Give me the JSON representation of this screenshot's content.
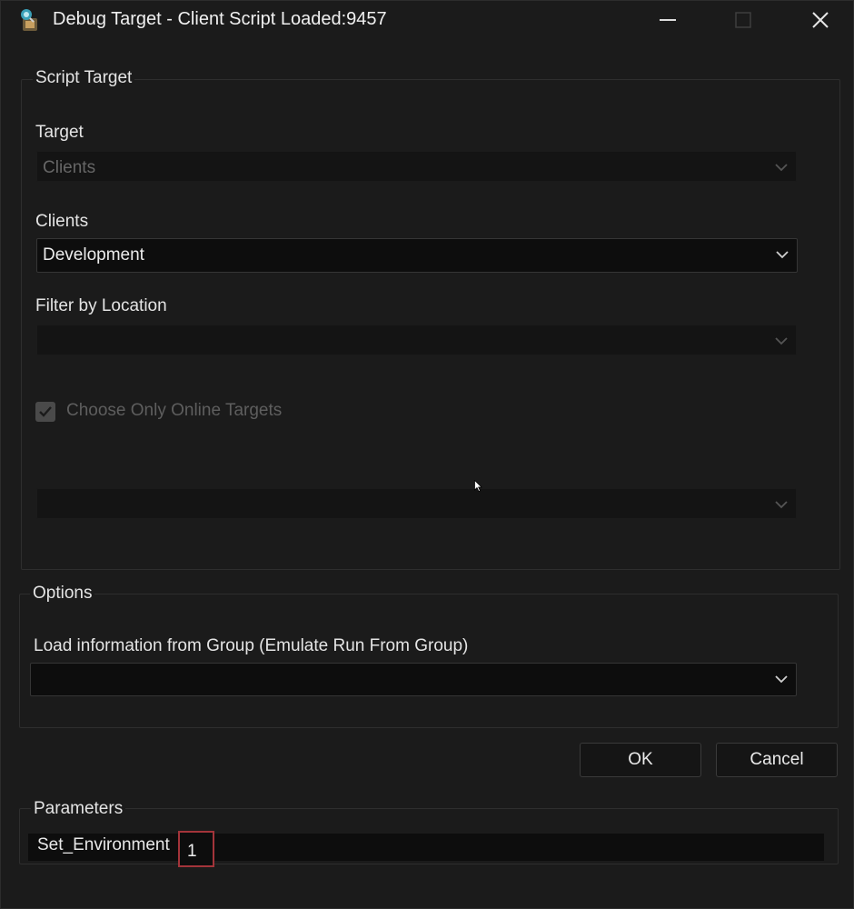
{
  "window": {
    "title": "Debug Target - Client Script Loaded:9457",
    "icons": {
      "app": "debug-bug-icon",
      "minimize": "minimize-icon",
      "maximize": "maximize-icon",
      "close": "close-icon"
    }
  },
  "script_target": {
    "legend": "Script Target",
    "target": {
      "label": "Target",
      "value": "Clients",
      "enabled": false
    },
    "clients": {
      "label": "Clients",
      "value": "Development",
      "enabled": true
    },
    "filter_location": {
      "label": "Filter by Location",
      "value": "",
      "enabled": false
    },
    "online_only": {
      "label": "Choose Only Online Targets",
      "checked": true,
      "enabled": false
    },
    "extra_select": {
      "value": "",
      "enabled": false
    }
  },
  "options": {
    "legend": "Options",
    "load_group": {
      "label": "Load information from Group (Emulate Run From Group)",
      "value": ""
    }
  },
  "buttons": {
    "ok": "OK",
    "cancel": "Cancel"
  },
  "parameters": {
    "legend": "Parameters",
    "items": [
      {
        "name": "Set_Environment",
        "value": "1"
      }
    ]
  },
  "colors": {
    "background": "#1b1b1b",
    "field": "#0d0d0d",
    "highlight": "#a3343a"
  }
}
